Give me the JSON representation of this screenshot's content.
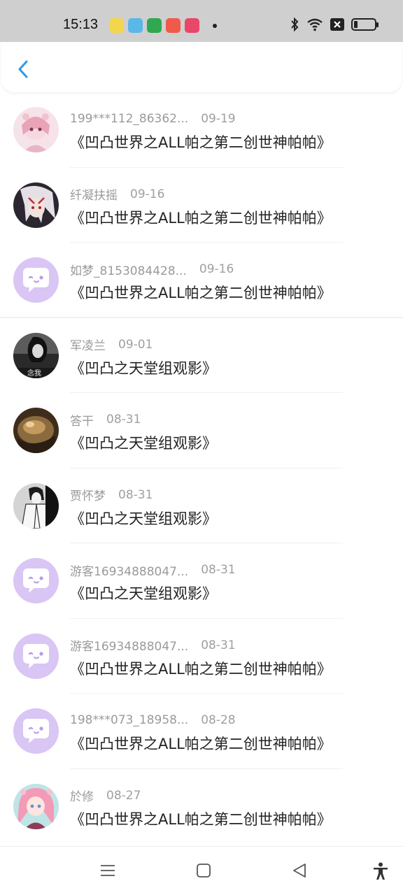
{
  "status_bar": {
    "time": "15:13",
    "app_icon_colors": [
      "#f4d64c",
      "#59b8e8",
      "#2fa84f",
      "#ef5a4a",
      "#e8476a"
    ]
  },
  "header": {
    "back_icon": "chevron-left-icon",
    "accent": "#2b9be6"
  },
  "items": [
    {
      "user": "199***112_86362...",
      "date": "09-19",
      "title": "《凹凸世界之ALL帕之第二创世神帕帕》",
      "avatar": "pink-anime-girl"
    },
    {
      "user": "纤凝扶摇",
      "date": "09-16",
      "title": "《凹凸世界之ALL帕之第二创世神帕帕》",
      "avatar": "white-hair-anime"
    },
    {
      "user": "如梦_8153084428...",
      "date": "09-16",
      "title": "《凹凸世界之ALL帕之第二创世神帕帕》",
      "avatar": "default-chat-bubble"
    },
    {
      "user": "军凌兰",
      "date": "09-01",
      "title": "《凹凸之天堂组观影》",
      "avatar": "bw-photo",
      "avatar_caption": "念我"
    },
    {
      "user": "答干",
      "date": "08-31",
      "title": "《凹凸之天堂组观影》",
      "avatar": "brown-closeup"
    },
    {
      "user": "贾怀梦",
      "date": "08-31",
      "title": "《凹凸之天堂组观影》",
      "avatar": "bw-suit-sketch"
    },
    {
      "user": "游客16934888047...",
      "date": "08-31",
      "title": "《凹凸之天堂组观影》",
      "avatar": "default-chat-bubble"
    },
    {
      "user": "游客16934888047...",
      "date": "08-31",
      "title": "《凹凸世界之ALL帕之第二创世神帕帕》",
      "avatar": "default-chat-bubble"
    },
    {
      "user": "198***073_18958...",
      "date": "08-28",
      "title": "《凹凸世界之ALL帕之第二创世神帕帕》",
      "avatar": "default-chat-bubble"
    },
    {
      "user": "於修",
      "date": "08-27",
      "title": "《凹凸世界之ALL帕之第二创世神帕帕》",
      "avatar": "pink-hair-anime"
    }
  ],
  "bottom_nav": [
    "menu-icon",
    "home-square-icon",
    "back-triangle-icon",
    "accessibility-icon"
  ]
}
